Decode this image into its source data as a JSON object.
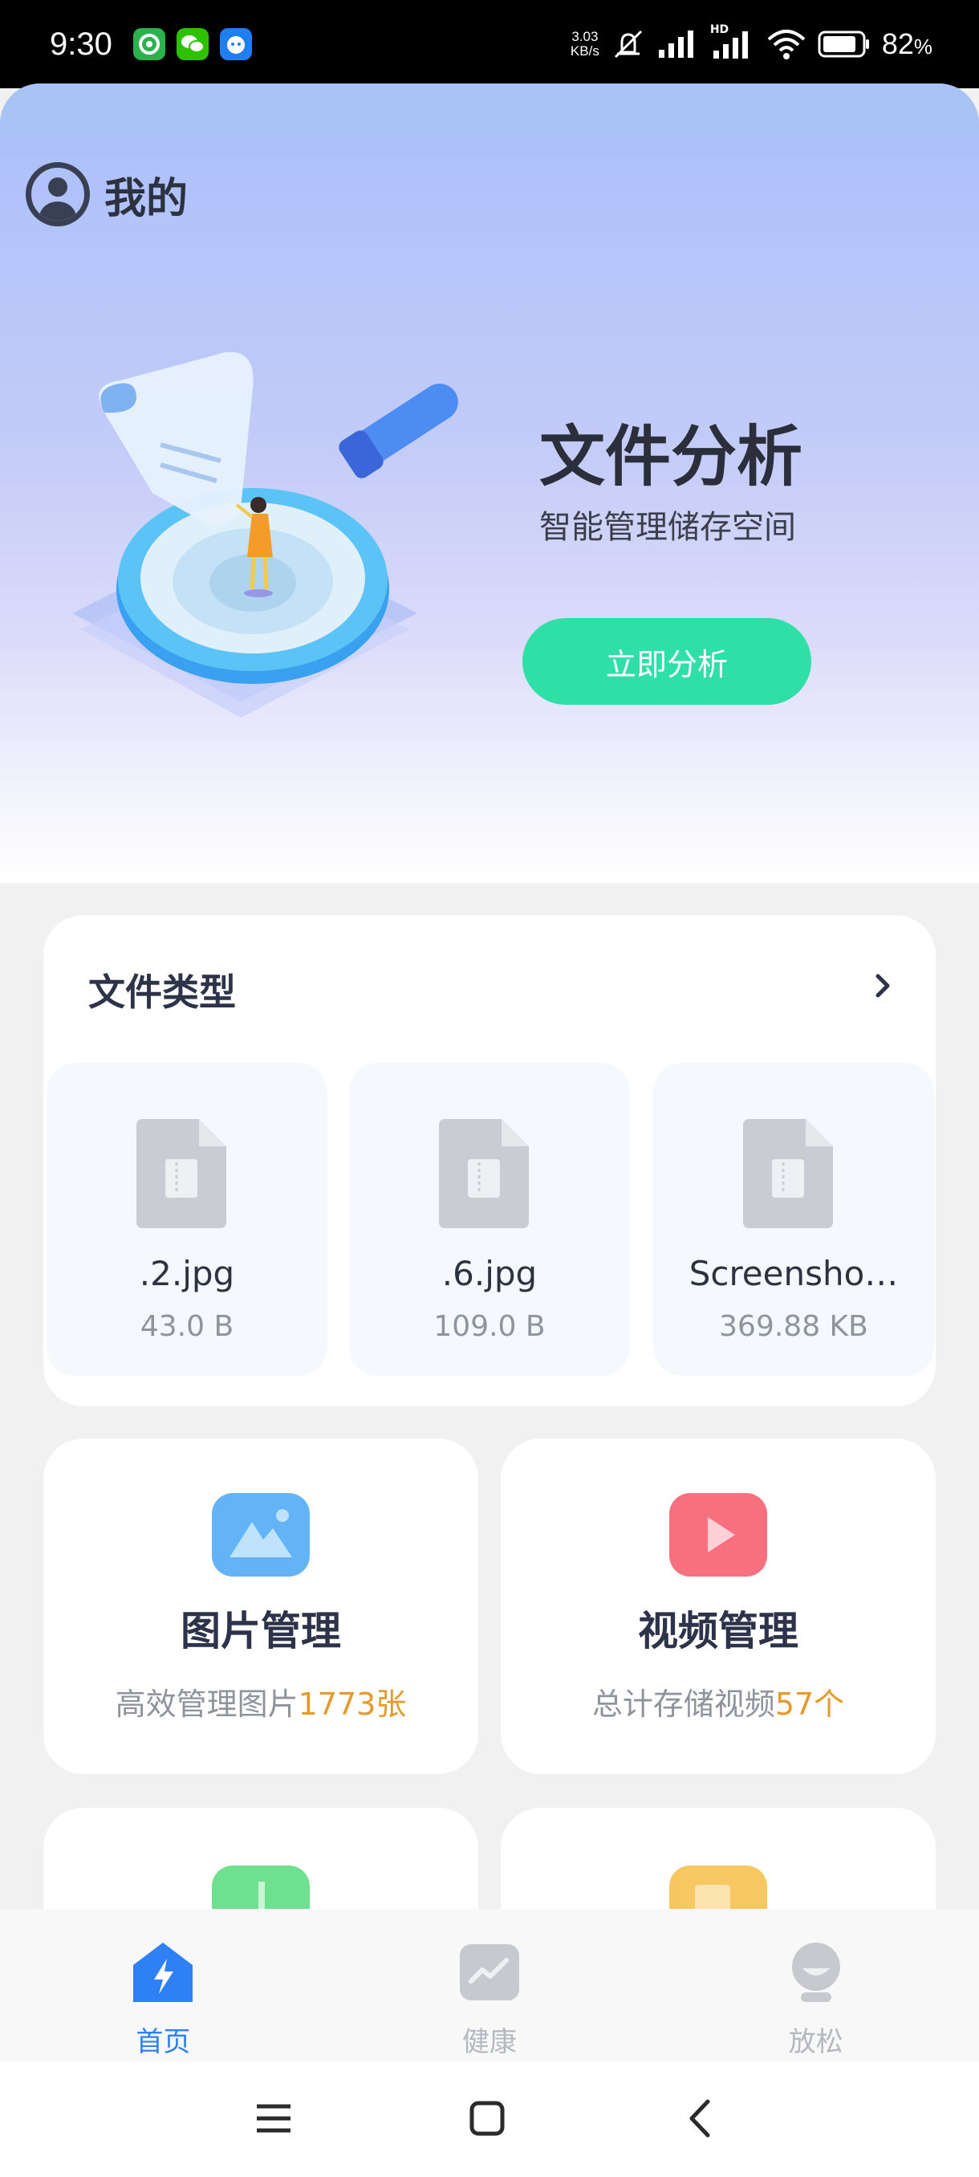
{
  "status_bar": {
    "time": "9:30",
    "net_speed_value": "3.03",
    "net_speed_unit": "KB/s",
    "battery_percent": "82",
    "battery_unit": "%",
    "signal_hd_label": "HD"
  },
  "header": {
    "profile_label": "我的"
  },
  "hero": {
    "title": "文件分析",
    "subtitle": "智能管理储存空间",
    "button_label": "立即分析"
  },
  "file_types": {
    "title": "文件类型",
    "items": [
      {
        "name": ".2.jpg",
        "size": "43.0 B"
      },
      {
        "name": ".6.jpg",
        "size": "109.0 B"
      },
      {
        "name": "Screensho…",
        "size": "369.88 KB"
      }
    ]
  },
  "manage": {
    "images": {
      "title": "图片管理",
      "desc_prefix": "高效管理图片",
      "desc_count": "1773张"
    },
    "videos": {
      "title": "视频管理",
      "desc_prefix": "总计存储视频",
      "desc_count": "57个"
    }
  },
  "bottom_nav": {
    "items": [
      {
        "label": "首页",
        "icon": "lightning-house-icon"
      },
      {
        "label": "健康",
        "icon": "trend-chart-icon"
      },
      {
        "label": "放松",
        "icon": "face-icon"
      }
    ]
  },
  "colors": {
    "accent_green": "#2ee0a6",
    "highlight_orange": "#e59a2c",
    "active_blue": "#2f7ff5"
  }
}
